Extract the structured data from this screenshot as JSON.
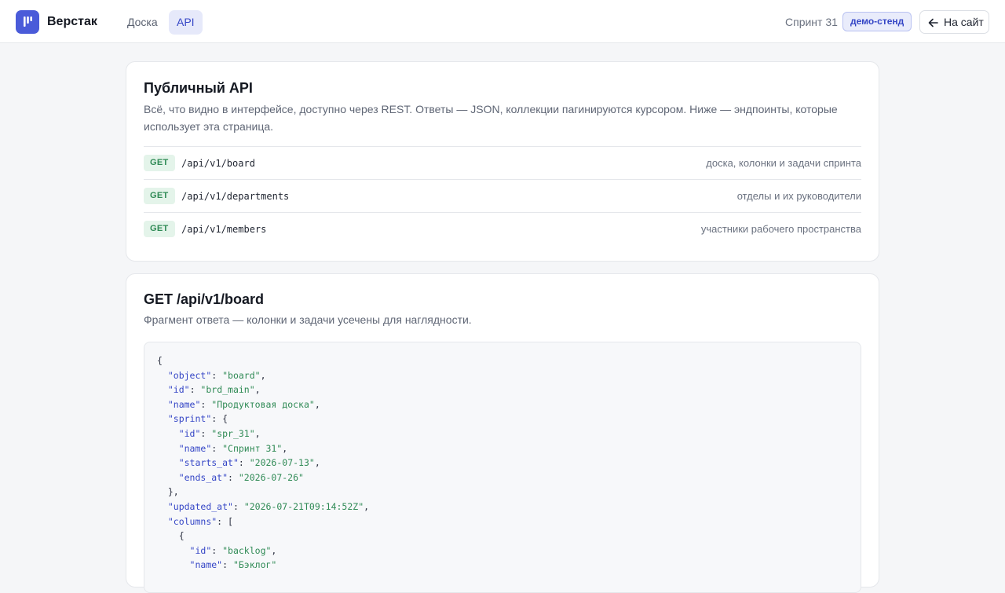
{
  "header": {
    "brand": "Верстак",
    "tabs": [
      {
        "label": "Доска",
        "active": false
      },
      {
        "label": "API",
        "active": true
      }
    ],
    "sprint": "Спринт 31",
    "env_badge": "демо-стенд",
    "site_button": "На сайт"
  },
  "overview": {
    "title": "Публичный API",
    "description": "Всё, что видно в интерфейсе, доступно через REST. Ответы — JSON, коллекции пагинируются курсором. Ниже — эндпоинты, которые использует эта страница.",
    "endpoints": [
      {
        "method": "GET",
        "path": "/api/v1/board",
        "description": "доска, колонки и задачи спринта"
      },
      {
        "method": "GET",
        "path": "/api/v1/departments",
        "description": "отделы и их руководители"
      },
      {
        "method": "GET",
        "path": "/api/v1/members",
        "description": "участники рабочего пространства"
      }
    ]
  },
  "detail": {
    "title": "GET /api/v1/board",
    "description": "Фрагмент ответа — колонки и задачи усечены для наглядности.",
    "code_lines": [
      [
        [
          "p",
          "{"
        ]
      ],
      [
        [
          "p",
          "  "
        ],
        [
          "k",
          "\"object\""
        ],
        [
          "p",
          ": "
        ],
        [
          "s",
          "\"board\""
        ],
        [
          "p",
          ","
        ]
      ],
      [
        [
          "p",
          "  "
        ],
        [
          "k",
          "\"id\""
        ],
        [
          "p",
          ": "
        ],
        [
          "s",
          "\"brd_main\""
        ],
        [
          "p",
          ","
        ]
      ],
      [
        [
          "p",
          "  "
        ],
        [
          "k",
          "\"name\""
        ],
        [
          "p",
          ": "
        ],
        [
          "s",
          "\"Продуктовая доска\""
        ],
        [
          "p",
          ","
        ]
      ],
      [
        [
          "p",
          "  "
        ],
        [
          "k",
          "\"sprint\""
        ],
        [
          "p",
          ": {"
        ]
      ],
      [
        [
          "p",
          "    "
        ],
        [
          "k",
          "\"id\""
        ],
        [
          "p",
          ": "
        ],
        [
          "s",
          "\"spr_31\""
        ],
        [
          "p",
          ","
        ]
      ],
      [
        [
          "p",
          "    "
        ],
        [
          "k",
          "\"name\""
        ],
        [
          "p",
          ": "
        ],
        [
          "s",
          "\"Спринт 31\""
        ],
        [
          "p",
          ","
        ]
      ],
      [
        [
          "p",
          "    "
        ],
        [
          "k",
          "\"starts_at\""
        ],
        [
          "p",
          ": "
        ],
        [
          "s",
          "\"2026-07-13\""
        ],
        [
          "p",
          ","
        ]
      ],
      [
        [
          "p",
          "    "
        ],
        [
          "k",
          "\"ends_at\""
        ],
        [
          "p",
          ": "
        ],
        [
          "s",
          "\"2026-07-26\""
        ]
      ],
      [
        [
          "p",
          "  },"
        ]
      ],
      [
        [
          "p",
          "  "
        ],
        [
          "k",
          "\"updated_at\""
        ],
        [
          "p",
          ": "
        ],
        [
          "s",
          "\"2026-07-21T09:14:52Z\""
        ],
        [
          "p",
          ","
        ]
      ],
      [
        [
          "p",
          "  "
        ],
        [
          "k",
          "\"columns\""
        ],
        [
          "p",
          ": ["
        ]
      ],
      [
        [
          "p",
          "    {"
        ]
      ],
      [
        [
          "p",
          "      "
        ],
        [
          "k",
          "\"id\""
        ],
        [
          "p",
          ": "
        ],
        [
          "s",
          "\"backlog\""
        ],
        [
          "p",
          ","
        ]
      ],
      [
        [
          "p",
          "      "
        ],
        [
          "k",
          "\"name\""
        ],
        [
          "p",
          ": "
        ],
        [
          "s",
          "\"Бэклог\""
        ]
      ]
    ]
  },
  "colors": {
    "accent": "#4a5bd9",
    "method_get": "#2f8a55",
    "json_key": "#3546c6",
    "json_string": "#2f8a55"
  },
  "icons": {
    "logo": "app-logo-icon",
    "back": "arrow-left-icon"
  }
}
